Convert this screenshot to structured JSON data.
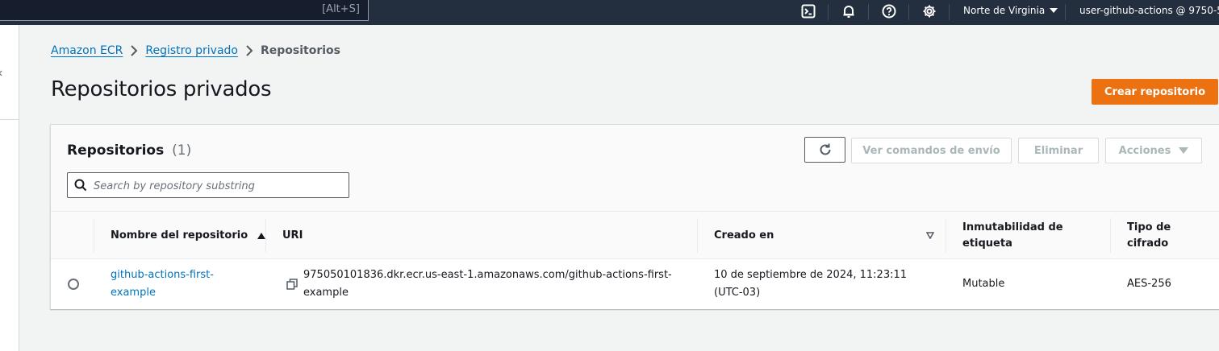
{
  "topbar": {
    "search_shortcut": "[Alt+S]",
    "region": "Norte de Virginia",
    "user": "user-github-actions @ 9750-50"
  },
  "breadcrumb": {
    "items": [
      "Amazon ECR",
      "Registro privado"
    ],
    "current": "Repositorios"
  },
  "page": {
    "title": "Repositorios privados",
    "create_button": "Crear repositorio"
  },
  "panel": {
    "title": "Repositorios",
    "count": "(1)",
    "buttons": {
      "push_commands": "Ver comandos de envío",
      "delete": "Eliminar",
      "actions": "Acciones"
    },
    "search_placeholder": "Search by repository substring"
  },
  "table": {
    "columns": {
      "name": "Nombre del repositorio",
      "uri": "URI",
      "created": "Creado en",
      "immutability_line1": "Inmutabilidad de",
      "immutability_line2": "etiqueta",
      "encryption_line1": "Tipo de",
      "encryption_line2": "cifrado"
    },
    "rows": [
      {
        "name_line1": "github-actions-first-",
        "name_line2": "example",
        "uri_line1": "975050101836.dkr.ecr.us-east-1.amazonaws.com/github-actions-first-",
        "uri_line2": "example",
        "created_line1": "10 de septiembre de 2024, 11:23:11",
        "created_line2": "(UTC-03)",
        "immutability": "Mutable",
        "encryption": "AES-256"
      }
    ]
  },
  "colors": {
    "topbar": "#232f3e",
    "primary": "#ec7211",
    "link": "#0073bb"
  },
  "icons": [
    "cloudshell-icon",
    "bell-icon",
    "help-icon",
    "gear-icon",
    "refresh-icon",
    "search-icon",
    "copy-icon"
  ]
}
